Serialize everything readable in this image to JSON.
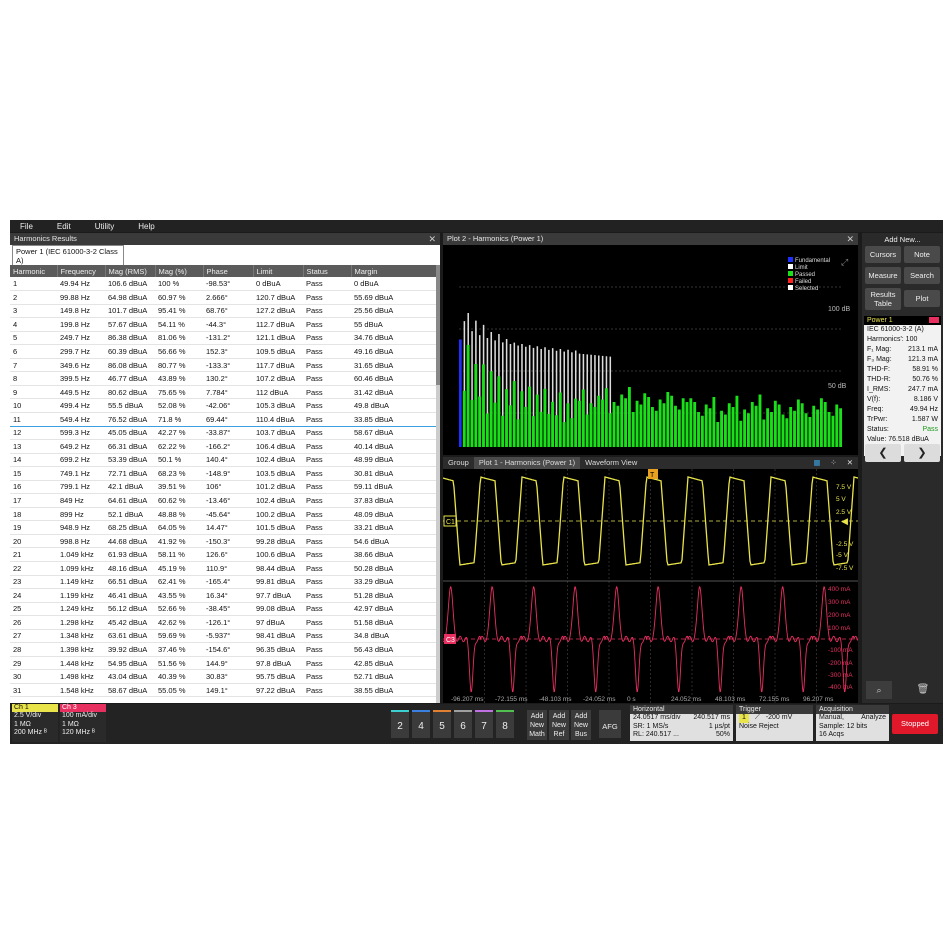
{
  "menu": [
    "File",
    "Edit",
    "Utility",
    "Help"
  ],
  "harmonics_panel": {
    "title": "Harmonics Results",
    "tab_label": "Power 1 (IEC 61000-3-2  Class A)",
    "columns": [
      "Harmonic",
      "Frequency",
      "Mag (RMS)",
      "Mag (%)",
      "Phase",
      "Limit",
      "Status",
      "Margin"
    ],
    "rows": [
      [
        "1",
        "49.94 Hz",
        "106.6 dBuA",
        "100 %",
        "-98.53°",
        "0 dBuA",
        "Pass",
        "0 dBuA"
      ],
      [
        "2",
        "99.88 Hz",
        "64.98 dBuA",
        "60.97 %",
        "2.666°",
        "120.7 dBuA",
        "Pass",
        "55.69 dBuA"
      ],
      [
        "3",
        "149.8 Hz",
        "101.7 dBuA",
        "95.41 %",
        "68.76°",
        "127.2 dBuA",
        "Pass",
        "25.56 dBuA"
      ],
      [
        "4",
        "199.8 Hz",
        "57.67 dBuA",
        "54.11 %",
        "-44.3°",
        "112.7 dBuA",
        "Pass",
        "55 dBuA"
      ],
      [
        "5",
        "249.7 Hz",
        "86.38 dBuA",
        "81.06 %",
        "-131.2°",
        "121.1 dBuA",
        "Pass",
        "34.76 dBuA"
      ],
      [
        "6",
        "299.7 Hz",
        "60.39 dBuA",
        "56.66 %",
        "152.3°",
        "109.5 dBuA",
        "Pass",
        "49.16 dBuA"
      ],
      [
        "7",
        "349.6 Hz",
        "86.08 dBuA",
        "80.77 %",
        "-133.3°",
        "117.7 dBuA",
        "Pass",
        "31.65 dBuA"
      ],
      [
        "8",
        "399.5 Hz",
        "46.77 dBuA",
        "43.89 %",
        "130.2°",
        "107.2 dBuA",
        "Pass",
        "60.46 dBuA"
      ],
      [
        "9",
        "449.5 Hz",
        "80.62 dBuA",
        "75.65 %",
        "7.784°",
        "112 dBuA",
        "Pass",
        "31.42 dBuA"
      ],
      [
        "10",
        "499.4 Hz",
        "55.5 dBuA",
        "52.08 %",
        "-42.06°",
        "105.3 dBuA",
        "Pass",
        "49.8 dBuA"
      ],
      [
        "11",
        "549.4 Hz",
        "76.52 dBuA",
        "71.8 %",
        "69.44°",
        "110.4 dBuA",
        "Pass",
        "33.85 dBuA"
      ],
      [
        "12",
        "599.3 Hz",
        "45.05 dBuA",
        "42.27 %",
        "-33.87°",
        "103.7 dBuA",
        "Pass",
        "58.67 dBuA"
      ],
      [
        "13",
        "649.2 Hz",
        "66.31 dBuA",
        "62.22 %",
        "-166.2°",
        "106.4 dBuA",
        "Pass",
        "40.14 dBuA"
      ],
      [
        "14",
        "699.2 Hz",
        "53.39 dBuA",
        "50.1 %",
        "140.4°",
        "102.4 dBuA",
        "Pass",
        "48.99 dBuA"
      ],
      [
        "15",
        "749.1 Hz",
        "72.71 dBuA",
        "68.23 %",
        "-148.9°",
        "103.5 dBuA",
        "Pass",
        "30.81 dBuA"
      ],
      [
        "16",
        "799.1 Hz",
        "42.1 dBuA",
        "39.51 %",
        "106°",
        "101.2 dBuA",
        "Pass",
        "59.11 dBuA"
      ],
      [
        "17",
        "849 Hz",
        "64.61 dBuA",
        "60.62 %",
        "-13.46°",
        "102.4 dBuA",
        "Pass",
        "37.83 dBuA"
      ],
      [
        "18",
        "899 Hz",
        "52.1 dBuA",
        "48.88 %",
        "-45.64°",
        "100.2 dBuA",
        "Pass",
        "48.09 dBuA"
      ],
      [
        "19",
        "948.9 Hz",
        "68.25 dBuA",
        "64.05 %",
        "14.47°",
        "101.5 dBuA",
        "Pass",
        "33.21 dBuA"
      ],
      [
        "20",
        "998.8 Hz",
        "44.68 dBuA",
        "41.92 %",
        "-150.3°",
        "99.28 dBuA",
        "Pass",
        "54.6 dBuA"
      ],
      [
        "21",
        "1.049 kHz",
        "61.93 dBuA",
        "58.11 %",
        "126.6°",
        "100.6 dBuA",
        "Pass",
        "38.66 dBuA"
      ],
      [
        "22",
        "1.099 kHz",
        "48.16 dBuA",
        "45.19 %",
        "110.9°",
        "98.44 dBuA",
        "Pass",
        "50.28 dBuA"
      ],
      [
        "23",
        "1.149 kHz",
        "66.51 dBuA",
        "62.41 %",
        "-165.4°",
        "99.81 dBuA",
        "Pass",
        "33.29 dBuA"
      ],
      [
        "24",
        "1.199 kHz",
        "46.41 dBuA",
        "43.55 %",
        "16.34°",
        "97.7 dBuA",
        "Pass",
        "51.28 dBuA"
      ],
      [
        "25",
        "1.249 kHz",
        "56.12 dBuA",
        "52.66 %",
        "-38.45°",
        "99.08 dBuA",
        "Pass",
        "42.97 dBuA"
      ],
      [
        "26",
        "1.298 kHz",
        "45.42 dBuA",
        "42.62 %",
        "-126.1°",
        "97 dBuA",
        "Pass",
        "51.58 dBuA"
      ],
      [
        "27",
        "1.348 kHz",
        "63.61 dBuA",
        "59.69 %",
        "-5.937°",
        "98.41 dBuA",
        "Pass",
        "34.8 dBuA"
      ],
      [
        "28",
        "1.398 kHz",
        "39.92 dBuA",
        "37.46 %",
        "-154.6°",
        "96.35 dBuA",
        "Pass",
        "56.43 dBuA"
      ],
      [
        "29",
        "1.448 kHz",
        "54.95 dBuA",
        "51.56 %",
        "144.9°",
        "97.8 dBuA",
        "Pass",
        "42.85 dBuA"
      ],
      [
        "30",
        "1.498 kHz",
        "43.04 dBuA",
        "40.39 %",
        "30.83°",
        "95.75 dBuA",
        "Pass",
        "52.71 dBuA"
      ],
      [
        "31",
        "1.548 kHz",
        "58.67 dBuA",
        "55.05 %",
        "149.1°",
        "97.22 dBuA",
        "Pass",
        "38.55 dBuA"
      ]
    ],
    "selected_row": 10
  },
  "plot2": {
    "title": "Plot 2 - Harmonics (Power 1)",
    "legend": [
      "Fundamental",
      "Limit",
      "Passed",
      "Failed",
      "Selected"
    ],
    "legend_colors": [
      "#1f2fff",
      "#ffffff",
      "#19e019",
      "#ff2020",
      "#ffffff"
    ],
    "y_tick_label": "50 dB",
    "y_tick_label_top": "100 dB"
  },
  "wave_panel": {
    "tabs": [
      "Group",
      "Plot 1 - Harmonics (Power 1)",
      "Waveform View"
    ],
    "ch1_labels": [
      "7.5 V",
      "5 V",
      "2.5 V",
      "-2.5 V",
      "-5 V",
      "-7.5 V"
    ],
    "ch3_labels": [
      "400 mA",
      "300 mA",
      "200 mA",
      "100 mA",
      "-100 mA",
      "-200 mA",
      "-300 mA",
      "-400 mA"
    ],
    "time_labels": [
      "-96.207 ms",
      "-72.155 ms",
      "-48.103 ms",
      "-24.052 ms",
      "0 s",
      "24.052 ms",
      "48.103 ms",
      "72.155 ms",
      "96.207 ms"
    ],
    "ch1_color": "#e8e44a",
    "ch3_color": "#e83060"
  },
  "right": {
    "add_new": "Add New...",
    "buttons": [
      "Cursors",
      "Note",
      "Measure",
      "Search",
      "Results Table",
      "Plot"
    ],
    "power_title": "Power 1",
    "power_rows": [
      [
        "IEC 61000-3-2 (A)",
        ""
      ],
      [
        "Harmonics': 100",
        ""
      ],
      [
        "F₁ Mag:",
        "213.1 mA"
      ],
      [
        "F₃ Mag:",
        "121.3 mA"
      ],
      [
        "THD-F:",
        "58.91 %"
      ],
      [
        "THD-R:",
        "50.76 %"
      ],
      [
        "I_RMS:",
        "247.7 mA"
      ],
      [
        "V(f):",
        "8.186 V"
      ],
      [
        "Freq:",
        "49.94 Hz"
      ],
      [
        "TrPwr:",
        "1.587 W"
      ],
      [
        "Status:",
        "Pass"
      ],
      [
        "Value: 76.518 dBuA",
        ""
      ]
    ],
    "nav_prev": "❮",
    "nav_next": "❯"
  },
  "bottom": {
    "ch1": {
      "title": "Ch 1",
      "lines": [
        "2.5 V/div",
        "1 MΩ",
        "200 MHz ᴮ"
      ],
      "color": "#e8e44a"
    },
    "ch3": {
      "title": "Ch 3",
      "lines": [
        "100 mA/div",
        "1 MΩ",
        "120 MHz ᴮ"
      ],
      "color": "#e83060"
    },
    "num_buttons": [
      "2",
      "4",
      "5",
      "6",
      "7",
      "8"
    ],
    "add_buttons": [
      [
        "Add",
        "New",
        "Math"
      ],
      [
        "Add",
        "New",
        "Ref"
      ],
      [
        "Add",
        "New",
        "Bus"
      ]
    ],
    "afg": "AFG",
    "horizontal": {
      "title": "Horizontal",
      "l1a": "24.0517 ms/div",
      "l1b": "240.517 ms",
      "l2a": "SR: 1 MS/s",
      "l2b": "1 µs/pt",
      "l3a": "RL: 240.517 ...",
      "l3b": "50%"
    },
    "trigger": {
      "title": "Trigger",
      "l1": "-200 mV",
      "l2": "Noise Reject",
      "ch": "1"
    },
    "acquisition": {
      "title": "Acquisition",
      "l1a": "Manual,",
      "l1b": "Analyze",
      "l2": "Sample: 12 bits",
      "l3": "16 Acqs"
    },
    "stopped": "Stopped"
  }
}
